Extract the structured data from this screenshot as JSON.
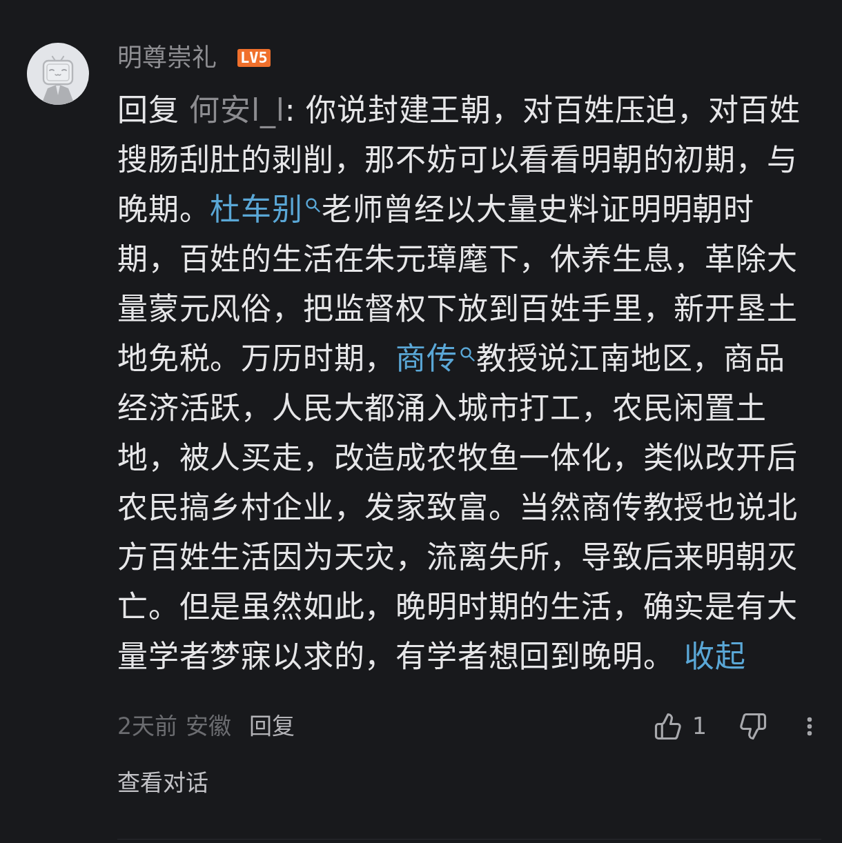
{
  "comment": {
    "author": {
      "name": "明尊崇礼",
      "level": "LV5"
    },
    "body": [
      {
        "kind": "text",
        "text": "回复 "
      },
      {
        "kind": "mention",
        "text": "何安l_l"
      },
      {
        "kind": "text",
        "text": ": 你说封建王朝，对百姓压迫，对百姓搜肠刮肚的剥削，那不妨可以看看明朝的初期，与晚期。"
      },
      {
        "kind": "search_link",
        "text": "杜车别"
      },
      {
        "kind": "text",
        "text": "老师曾经以大量史料证明明朝时期，百姓的生活在朱元璋麾下，休养生息，革除大量蒙元风俗，把监督权下放到百姓手里，新开垦土地免税。万历时期，"
      },
      {
        "kind": "search_link",
        "text": "商传"
      },
      {
        "kind": "text",
        "text": "教授说江南地区，商品经济活跃，人民大都涌入城市打工，农民闲置土地，被人买走，改造成农牧鱼一体化，类似改开后农民搞乡村企业，发家致富。当然商传教授也说北方百姓生活因为天灾，流离失所，导致后来明朝灭亡。但是虽然如此，晚明时期的生活，确实是有大量学者梦寐以求的，有学者想回到晚明。 "
      },
      {
        "kind": "collapse_link",
        "text": "收起"
      }
    ],
    "meta": {
      "time": "2天前",
      "location": "安徽",
      "reply": "回复"
    },
    "likes": "1",
    "view_conversation": "查看对话"
  }
}
